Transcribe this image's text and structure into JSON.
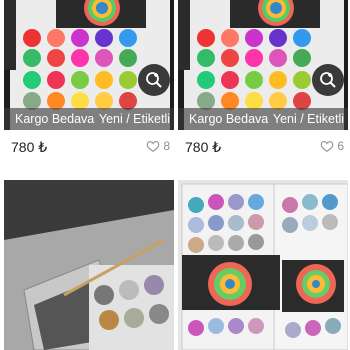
{
  "listings": [
    {
      "shipping_badge": "Kargo Bedava",
      "condition_badge": "Yeni / Etiketli",
      "price": "780 ₺",
      "likes": "8"
    },
    {
      "shipping_badge": "Kargo Bedava",
      "condition_badge": "Yeni / Etiketli",
      "price": "780 ₺",
      "likes": "6"
    }
  ],
  "colors": {
    "ribbon": "rgba(60,60,60,0.62)",
    "text": "#1f1f1f",
    "muted": "#8e8e8e"
  },
  "icons": [
    "magnify-plus-icon",
    "heart-outline-icon"
  ]
}
